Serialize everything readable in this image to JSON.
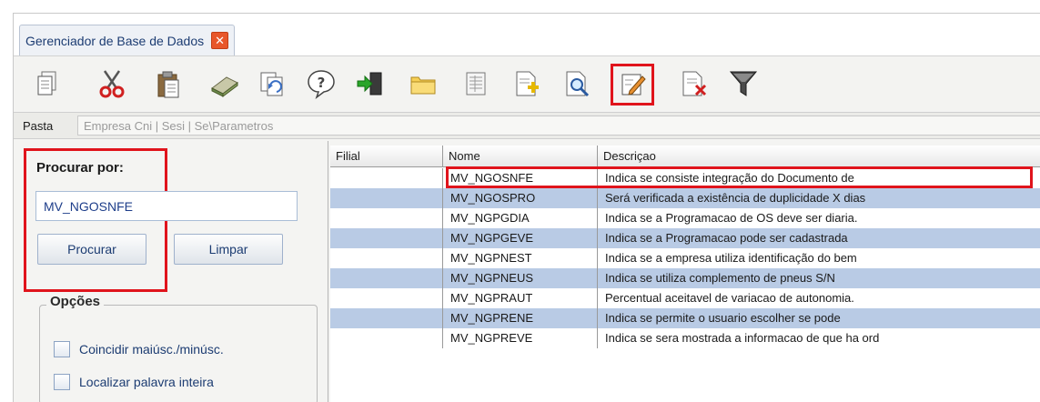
{
  "tab": {
    "title": "Gerenciador de Base de Dados",
    "close_symbol": "✕"
  },
  "toolbar": {
    "buttons": [
      {
        "icon": "copy-icon"
      },
      {
        "icon": "cut-icon"
      },
      {
        "icon": "paste-icon"
      },
      {
        "icon": "eraser-icon"
      },
      {
        "icon": "refresh-icon"
      },
      {
        "icon": "help-icon"
      },
      {
        "icon": "exit-icon"
      },
      {
        "icon": "folder-icon"
      },
      {
        "icon": "document-view-icon"
      },
      {
        "icon": "add-document-icon"
      },
      {
        "icon": "search-document-icon"
      },
      {
        "icon": "edit-icon",
        "highlighted": true
      },
      {
        "icon": "delete-document-icon"
      },
      {
        "icon": "filter-icon"
      }
    ]
  },
  "pasta": {
    "label": "Pasta",
    "path": "Empresa Cni | Sesi | Se\\Parametros"
  },
  "search": {
    "label": "Procurar por:",
    "value": "MV_NGOSNFE",
    "search_button": "Procurar",
    "clear_button": "Limpar"
  },
  "options": {
    "title": "Opções",
    "match_case": "Coincidir maiúsc./minúsc.",
    "whole_word": "Localizar palavra inteira"
  },
  "grid": {
    "columns": [
      "Filial",
      "Nome",
      "Descriçao"
    ],
    "rows": [
      {
        "filial": "",
        "nome": "MV_NGOSNFE",
        "descricao": "Indica se consiste integração do Documento de"
      },
      {
        "filial": "",
        "nome": "MV_NGOSPRO",
        "descricao": "Será verificada a existência de duplicidade X dias"
      },
      {
        "filial": "",
        "nome": "MV_NGPGDIA",
        "descricao": "Indica se a Programacao de OS deve ser diaria."
      },
      {
        "filial": "",
        "nome": "MV_NGPGEVE",
        "descricao": "Indica se a Programacao pode ser cadastrada"
      },
      {
        "filial": "",
        "nome": "MV_NGPNEST",
        "descricao": "Indica se a empresa utiliza identificação do bem"
      },
      {
        "filial": "",
        "nome": "MV_NGPNEUS",
        "descricao": "Indica se utiliza complemento de pneus S/N"
      },
      {
        "filial": "",
        "nome": "MV_NGPRAUT",
        "descricao": "Percentual aceitavel de variacao de autonomia."
      },
      {
        "filial": "",
        "nome": "MV_NGPRENE",
        "descricao": "Indica se permite o usuario escolher se pode"
      },
      {
        "filial": "",
        "nome": "MV_NGPREVE",
        "descricao": "Indica se sera mostrada a informacao de que ha ord"
      }
    ]
  },
  "colors": {
    "row_alt": "#b9cbe5",
    "highlight": "#e0141c",
    "tab_close": "#e8572b",
    "link_text": "#1c3c72"
  }
}
